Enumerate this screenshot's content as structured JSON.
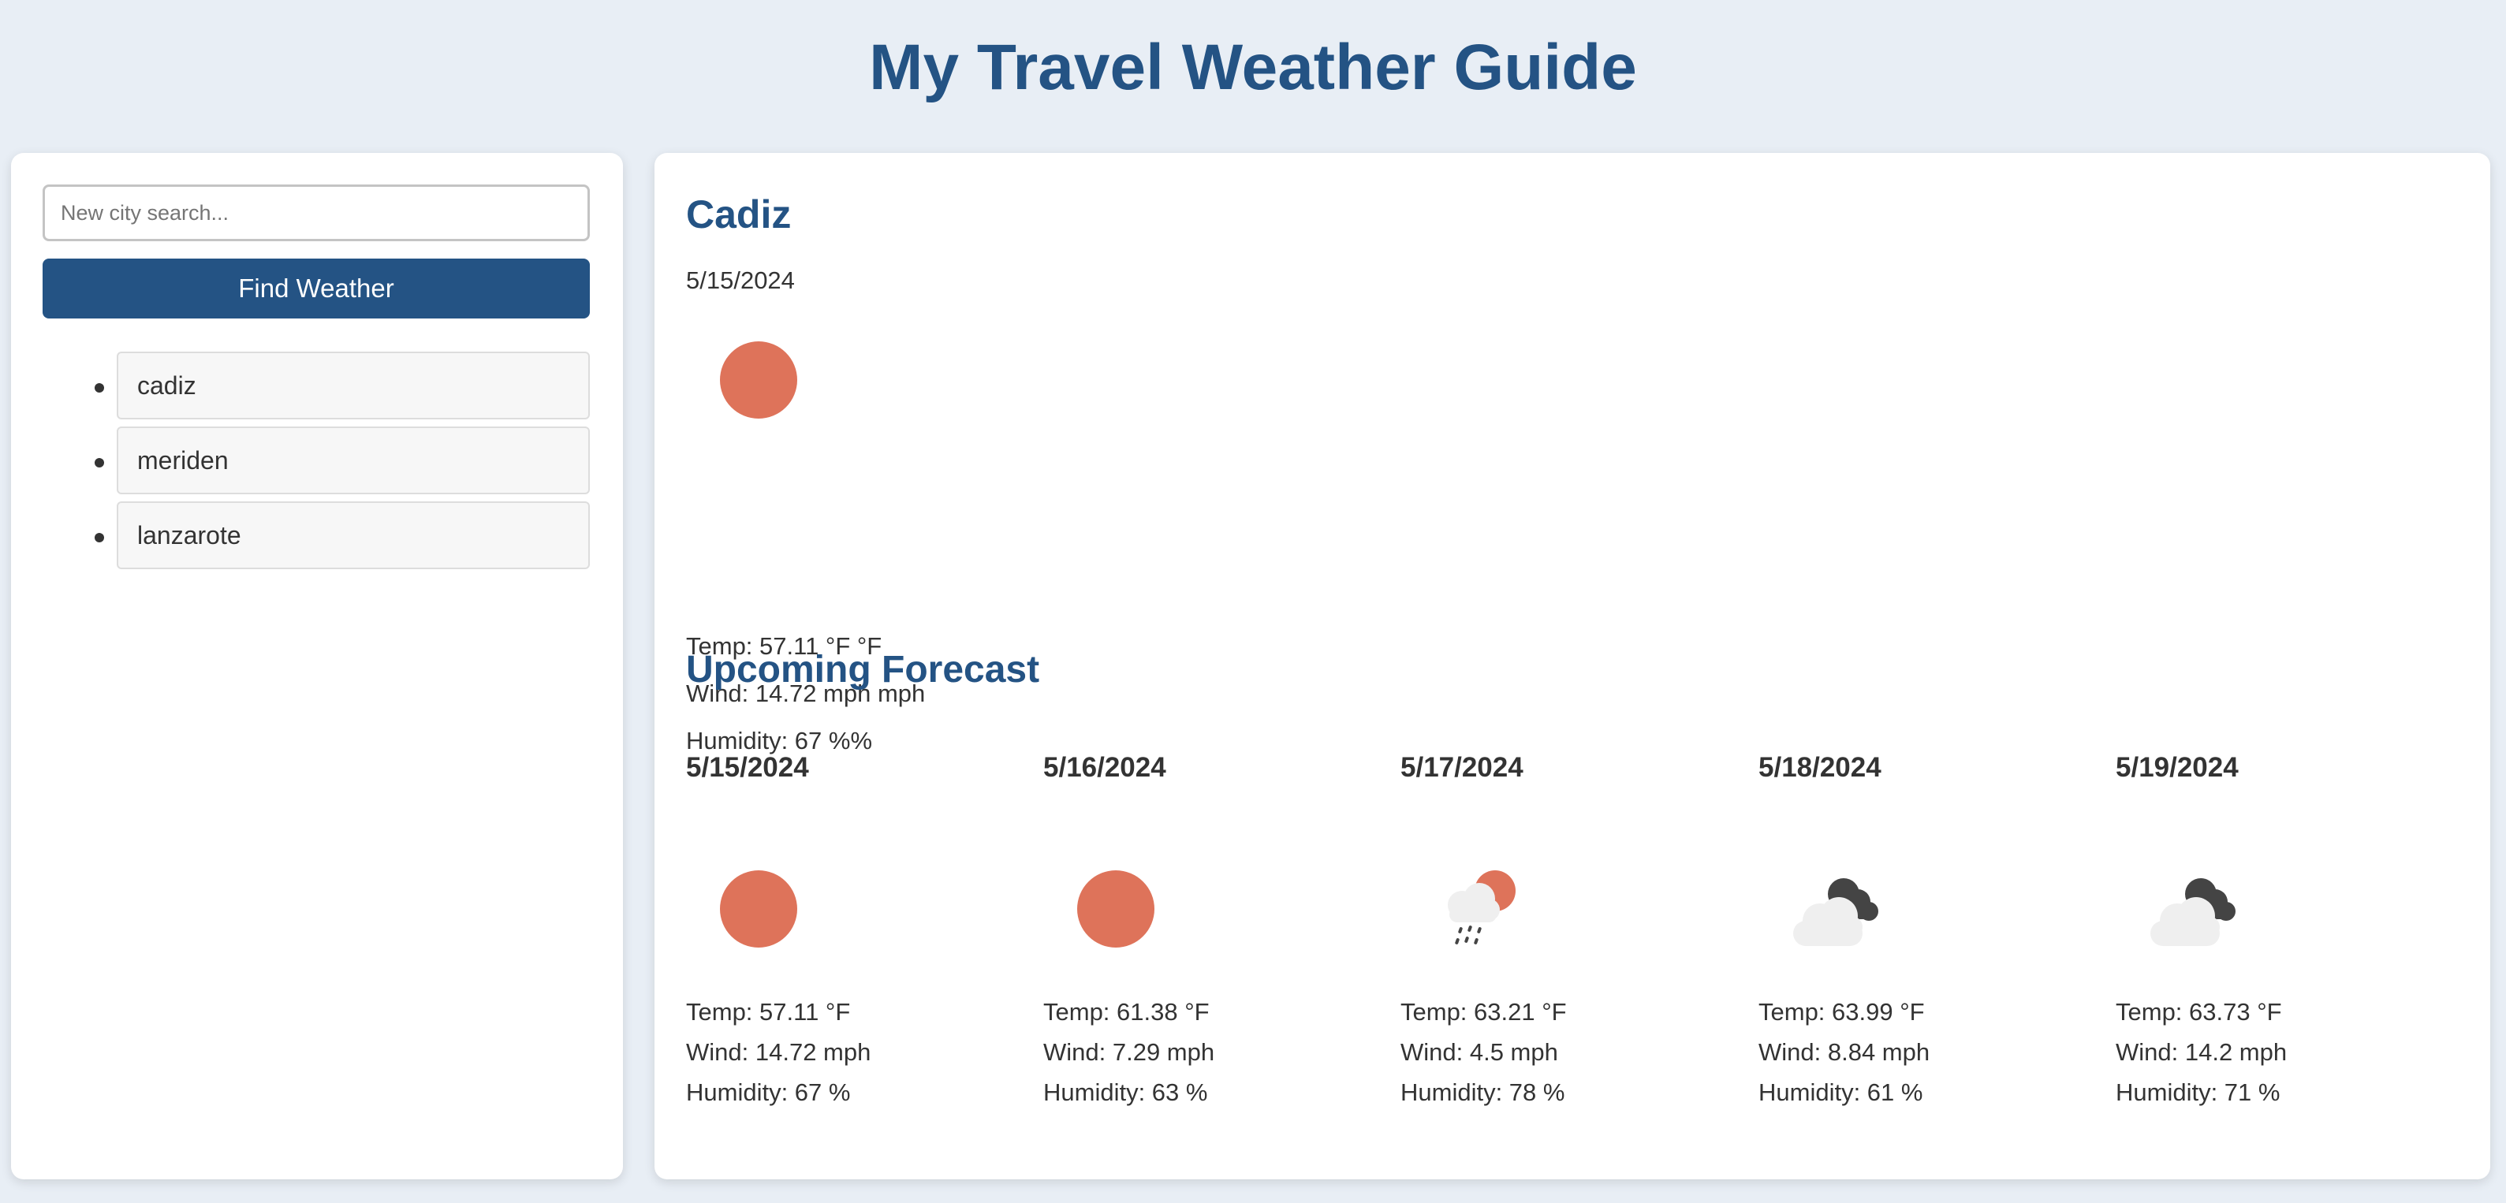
{
  "header": {
    "title": "My Travel Weather Guide"
  },
  "sidebar": {
    "search_placeholder": "New city search...",
    "search_value": "",
    "find_button_label": "Find Weather",
    "history": [
      {
        "label": "cadiz"
      },
      {
        "label": "meriden"
      },
      {
        "label": "lanzarote"
      }
    ]
  },
  "current": {
    "city": "Cadiz",
    "date": "5/15/2024",
    "icon": "clear-sun-icon",
    "temp": "Temp: 57.11 °F °F",
    "wind": "Wind: 14.72 mph mph",
    "humidity": "Humidity: 67 %%"
  },
  "forecast": {
    "title": "Upcoming Forecast",
    "days": [
      {
        "date": "5/15/2024",
        "icon": "clear-sun-icon",
        "temp": "Temp: 57.11 °F",
        "wind": "Wind: 14.72 mph",
        "humidity": "Humidity: 67 %"
      },
      {
        "date": "5/16/2024",
        "icon": "clear-sun-icon",
        "temp": "Temp: 61.38 °F",
        "wind": "Wind: 7.29 mph",
        "humidity": "Humidity: 63 %"
      },
      {
        "date": "5/17/2024",
        "icon": "sun-rain-icon",
        "temp": "Temp: 63.21 °F",
        "wind": "Wind: 4.5 mph",
        "humidity": "Humidity: 78 %"
      },
      {
        "date": "5/18/2024",
        "icon": "broken-clouds-icon",
        "temp": "Temp: 63.99 °F",
        "wind": "Wind: 8.84 mph",
        "humidity": "Humidity: 61 %"
      },
      {
        "date": "5/19/2024",
        "icon": "broken-clouds-icon",
        "temp": "Temp: 63.73 °F",
        "wind": "Wind: 14.2 mph",
        "humidity": "Humidity: 71 %"
      }
    ]
  },
  "colors": {
    "page_background": "#e8eef5",
    "brand": "#245384",
    "sun": "#de735a",
    "cloud_light": "#eeeeee",
    "cloud_dark": "#444444",
    "text": "#333333"
  }
}
